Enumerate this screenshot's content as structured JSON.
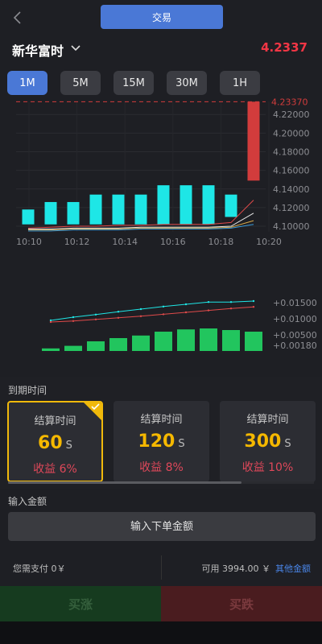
{
  "header": {
    "back_icon": "chevron-left-icon",
    "trade_label": "交易"
  },
  "asset": {
    "name": "新华富时",
    "dropdown_icon": "chevron-down-icon",
    "price": "4.2337"
  },
  "periods": [
    {
      "label": "1M",
      "active": true
    },
    {
      "label": "5M",
      "active": false
    },
    {
      "label": "15M",
      "active": false
    },
    {
      "label": "30M",
      "active": false
    },
    {
      "label": "1H",
      "active": false
    }
  ],
  "colors": {
    "accent": "#4a78d6",
    "up": "#1ee6e6",
    "down": "#d23c3c",
    "gold": "#f0b90b",
    "profit": "#e0485a",
    "macd": "#22c55e"
  },
  "chart_data": [
    {
      "type": "bar",
      "title": "",
      "x_ticks": [
        "10:10",
        "10:12",
        "10:14",
        "10:16",
        "10:18",
        "10:20"
      ],
      "y_ticks": [
        "4.10000",
        "4.12000",
        "4.14000",
        "4.16000",
        "4.18000",
        "4.20000",
        "4.22000"
      ],
      "last_price_label": "4.23370",
      "ylim": [
        4.094,
        4.234
      ],
      "candles": [
        {
          "open": 4.102,
          "close": 4.118
        },
        {
          "open": 4.102,
          "close": 4.126
        },
        {
          "open": 4.102,
          "close": 4.126
        },
        {
          "open": 4.102,
          "close": 4.134
        },
        {
          "open": 4.102,
          "close": 4.134
        },
        {
          "open": 4.102,
          "close": 4.134
        },
        {
          "open": 4.102,
          "close": 4.144
        },
        {
          "open": 4.102,
          "close": 4.144
        },
        {
          "open": 4.102,
          "close": 4.144
        },
        {
          "open": 4.11,
          "close": 4.134
        },
        {
          "open": 4.2337,
          "close": 4.149
        }
      ],
      "lines": [
        {
          "color": "#e04a4a",
          "values": [
            4.098,
            4.099,
            4.1,
            4.1,
            4.101,
            4.101,
            4.102,
            4.102,
            4.102,
            4.104,
            4.128
          ]
        },
        {
          "color": "#e8e8e8",
          "values": [
            4.097,
            4.097,
            4.098,
            4.098,
            4.098,
            4.099,
            4.099,
            4.099,
            4.099,
            4.1,
            4.114
          ]
        },
        {
          "color": "#d6a84a",
          "values": [
            4.096,
            4.096,
            4.097,
            4.097,
            4.097,
            4.098,
            4.098,
            4.098,
            4.098,
            4.099,
            4.106
          ]
        },
        {
          "color": "#3a9ad9",
          "values": [
            4.095,
            4.095,
            4.096,
            4.096,
            4.096,
            4.097,
            4.097,
            4.097,
            4.097,
            4.098,
            4.102
          ]
        }
      ],
      "grid": true
    },
    {
      "type": "bar",
      "title": "",
      "y_ticks": [
        "+0.00180",
        "+0.00500",
        "+0.01000",
        "+0.01500"
      ],
      "ylim": [
        0.0,
        0.018
      ],
      "histogram": [
        0.0008,
        0.0016,
        0.003,
        0.004,
        0.0048,
        0.006,
        0.0067,
        0.007,
        0.0065,
        0.006
      ],
      "lines": [
        {
          "color": "#1ee6e6",
          "values": [
            0.0095,
            0.0105,
            0.0113,
            0.0122,
            0.013,
            0.0138,
            0.0145,
            0.0152,
            0.0152,
            0.0155
          ]
        },
        {
          "color": "#e04a4a",
          "values": [
            0.009,
            0.0093,
            0.0098,
            0.0103,
            0.0108,
            0.0114,
            0.012,
            0.0126,
            0.0132,
            0.0137
          ]
        }
      ]
    }
  ],
  "expiry": {
    "title": "到期时间",
    "options": [
      {
        "label": "结算时间",
        "seconds": "60",
        "unit": "S",
        "profit": "收益 6%",
        "selected": true
      },
      {
        "label": "结算时间",
        "seconds": "120",
        "unit": "S",
        "profit": "收益 8%",
        "selected": false
      },
      {
        "label": "结算时间",
        "seconds": "300",
        "unit": "S",
        "profit": "收益 10%",
        "selected": false
      }
    ]
  },
  "amount": {
    "title": "输入金额",
    "placeholder": "输入下单金额"
  },
  "pay": {
    "need_pay": "您需支付 0￥",
    "available": "可用 3994.00 ￥",
    "other_amount": "其他金额"
  },
  "actions": {
    "buy_up": "买涨",
    "buy_down": "买跌"
  }
}
